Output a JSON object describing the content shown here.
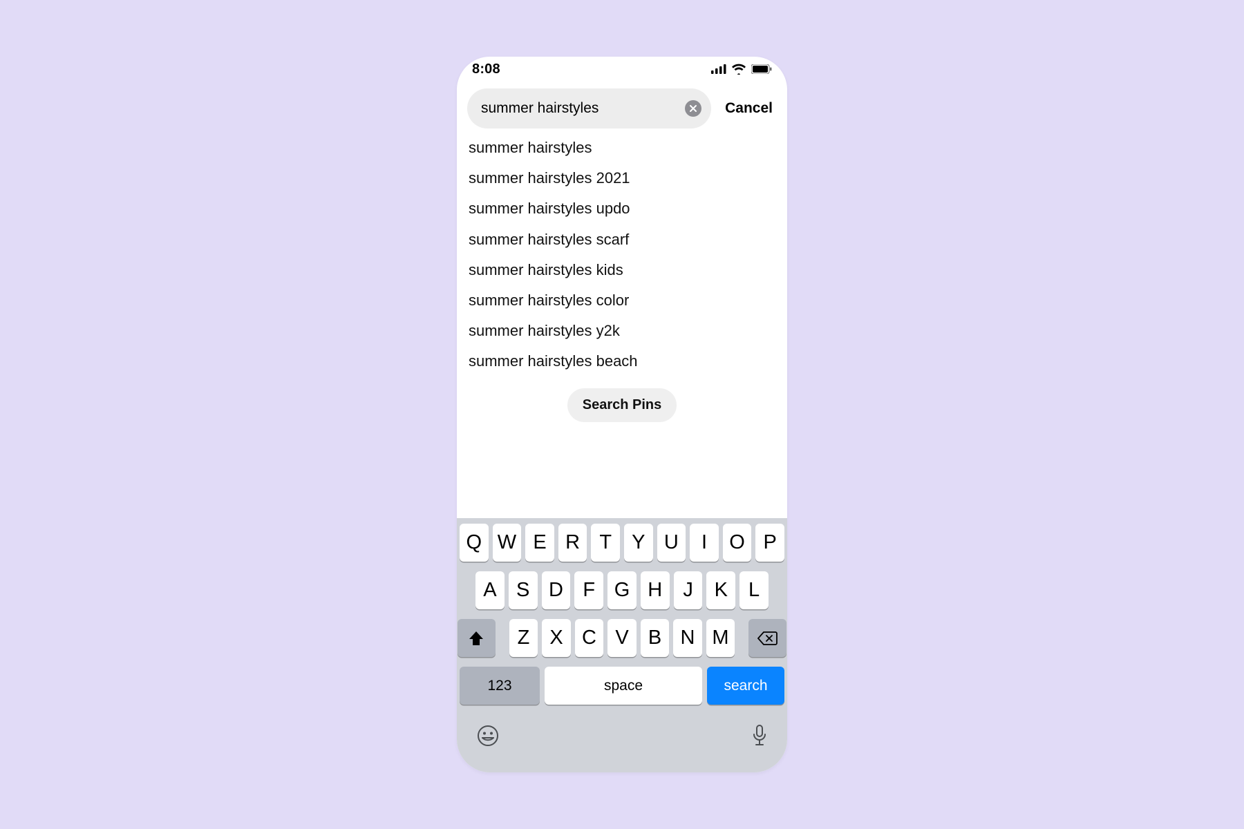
{
  "status_bar": {
    "time": "8:08"
  },
  "search": {
    "query": "summer hairstyles",
    "cancel_label": "Cancel"
  },
  "suggestions": [
    {
      "label": "summer hairstyles"
    },
    {
      "label": "summer hairstyles 2021"
    },
    {
      "label": "summer hairstyles updo"
    },
    {
      "label": "summer hairstyles scarf"
    },
    {
      "label": "summer hairstyles kids"
    },
    {
      "label": "summer hairstyles color"
    },
    {
      "label": "summer hairstyles y2k"
    },
    {
      "label": "summer hairstyles beach"
    }
  ],
  "actions": {
    "search_pins_label": "Search Pins"
  },
  "keyboard": {
    "row1": [
      "Q",
      "W",
      "E",
      "R",
      "T",
      "Y",
      "U",
      "I",
      "O",
      "P"
    ],
    "row2": [
      "A",
      "S",
      "D",
      "F",
      "G",
      "H",
      "J",
      "K",
      "L"
    ],
    "row3": [
      "Z",
      "X",
      "C",
      "V",
      "B",
      "N",
      "M"
    ],
    "num_label": "123",
    "space_label": "space",
    "action_label": "search"
  }
}
